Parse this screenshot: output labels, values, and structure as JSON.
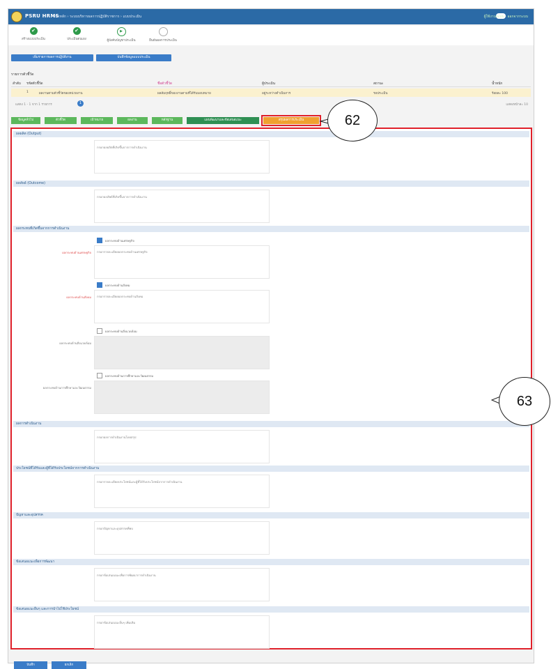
{
  "topbar": {
    "brand": "PSRU HRMS",
    "crumb": "หน้าหลัก  ›  ระบบบริหารผลการปฏิบัติราชการ  ›  แบบประเมิน",
    "user": "ผู้ใช้งานระบบ  ·  ออกจากระบบ"
  },
  "steps": [
    {
      "label": "สร้างแบบประเมิน",
      "state": "done"
    },
    {
      "label": "ประเมินตนเอง",
      "state": "done"
    },
    {
      "label": "ผู้บังคับบัญชาประเมิน",
      "state": "current"
    },
    {
      "label": "ยืนยันผลการประเมิน",
      "state": "todo"
    }
  ],
  "action_buttons": [
    "เพิ่มรายการผลการปฏิบัติงาน",
    "บันทึกข้อมูลแบบประเมิน"
  ],
  "list": {
    "caption": "รายการตัวชี้วัด",
    "headers": [
      "ลำดับ",
      "รหัสตัวชี้วัด",
      "ชื่อตัวชี้วัด",
      "ผู้ประเมิน",
      "สถานะ",
      "น้ำหนัก"
    ],
    "row": [
      "1",
      "ผลงานตามตัวชี้วัดของหน่วยงาน",
      "ผลสัมฤทธิ์ของงานตามที่ได้รับมอบหมาย",
      "อยู่ระหว่างดำเนินการ",
      "รอประเมิน",
      "ร้อยละ 100"
    ],
    "pager": "แสดง 1 - 1 จาก 1 รายการ",
    "page": "1",
    "pagesize": "แสดงหน้าละ 10"
  },
  "tabs": [
    {
      "label": "ข้อมูลทั่วไป",
      "style": "green"
    },
    {
      "label": "ตัวชี้วัด",
      "style": "green"
    },
    {
      "label": "เป้าหมาย",
      "style": "green"
    },
    {
      "label": "ผลงาน",
      "style": "green"
    },
    {
      "label": "หลักฐาน",
      "style": "green"
    },
    {
      "label": "แผนพัฒนาและข้อเสนอแนะ",
      "style": "dark"
    },
    {
      "label": "สรุปผลการประเมิน",
      "style": "orange"
    }
  ],
  "callouts": [
    "62",
    "63"
  ],
  "sections": [
    {
      "title": "ผลผลิต (Output)",
      "hint": "กรอกผลผลิตที่เกิดขึ้นจากการดำเนินงาน"
    },
    {
      "title": "ผลลัพธ์ (Outcome)",
      "hint": "กรอกผลลัพธ์ที่เกิดขึ้นจากการดำเนินงาน"
    },
    {
      "title": "ผลกระทบที่เกิดขึ้นจากการดำเนินงาน",
      "hint": ""
    },
    {
      "title": "ผลการดำเนินงาน",
      "hint": "กรอกผลการดำเนินงานโดยสรุป"
    },
    {
      "title": "ประโยชน์ที่ได้รับและผู้ที่ได้รับประโยชน์จากการดำเนินงาน",
      "hint": "กรอกรายละเอียดประโยชน์และผู้ที่ได้รับประโยชน์จากการดำเนินงาน"
    },
    {
      "title": "ปัญหาและอุปสรรค",
      "hint": "กรอกปัญหาและอุปสรรคที่พบ"
    },
    {
      "title": "ข้อเสนอแนะเพื่อการพัฒนา",
      "hint": "กรอกข้อเสนอแนะเพื่อการพัฒนาการดำเนินงาน"
    },
    {
      "title": "ข้อเสนอแนะอื่นๆ และการนำไปใช้ประโยชน์",
      "hint": "กรอกข้อเสนอแนะอื่นๆ เพิ่มเติม"
    }
  ],
  "impact": {
    "items": [
      {
        "checked": true,
        "check_label": "ผลกระทบด้านเศรษฐกิจ",
        "side_label": "ผลกระทบด้านเศรษฐกิจ",
        "hint": "กรอกรายละเอียดผลกระทบด้านเศรษฐกิจ",
        "box": "white",
        "label_color": "red"
      },
      {
        "checked": true,
        "check_label": "ผลกระทบด้านสังคม",
        "side_label": "ผลกระทบด้านสังคม",
        "hint": "กรอกรายละเอียดผลกระทบด้านสังคม",
        "box": "white",
        "label_color": "red"
      },
      {
        "checked": false,
        "check_label": "ผลกระทบด้านสิ่งแวดล้อม",
        "side_label": "ผลกระทบด้านสิ่งแวดล้อม",
        "hint": "",
        "box": "grey",
        "label_color": "grey"
      },
      {
        "checked": false,
        "check_label": "ผลกระทบด้านการศึกษาและวัฒนธรรม",
        "side_label": "ผลกระทบด้านการศึกษาและวัฒนธรรม",
        "hint": "",
        "box": "grey",
        "label_color": "grey"
      }
    ]
  },
  "bottom_buttons": [
    "บันทึก",
    "ยกเลิก"
  ],
  "colors": {
    "topbar": "#2b6aa6",
    "accent": "#3a7cc8",
    "highlight": "#e0202a",
    "tab_active": "#f0a030"
  }
}
